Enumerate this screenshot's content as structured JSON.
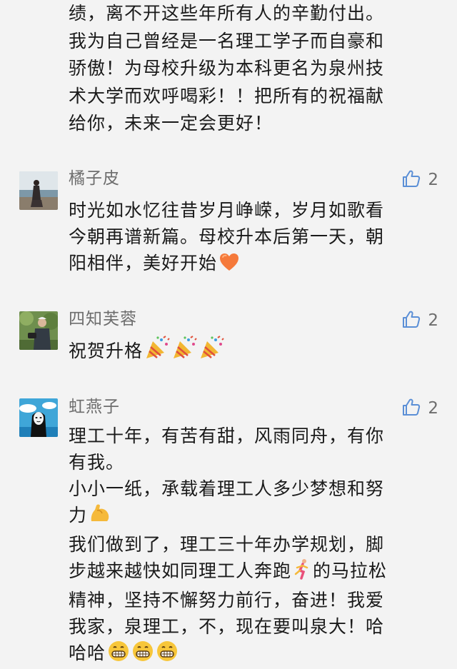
{
  "previous_comment": {
    "lines": [
      "绩，离不开这些年所有人的辛勤付出。",
      "我为自己曾经是一名理工学子而自豪和",
      "骄傲！为母校升级为本科更名为泉州技",
      "术大学而欢呼喝彩！！把所有的祝福献",
      "给你，未来一定会更好！"
    ]
  },
  "comments": [
    {
      "nickname": "橘子皮",
      "likes": "2",
      "lines": [
        "时光如水忆往昔岁月峥嵘，岁月如歌看",
        "今朝再谱新篇。母校升本后第一天，朝",
        "阳相伴，美好开始"
      ]
    },
    {
      "nickname": "四知芙蓉",
      "likes": "2",
      "lines": [
        "祝贺升格"
      ]
    },
    {
      "nickname": "虹燕子",
      "likes": "2",
      "lines": [
        "理工十年，有苦有甜，风雨同舟，有你",
        "有我。",
        "小小一纸，承载着理工人多少梦想和努",
        "力",
        "我们做到了，理工三十年办学规划，脚",
        "步越来越快如同理工人奔跑",
        "的马拉松",
        "精神，坚持不懈努力前行，奋进！我爱",
        "我家，泉理工，不，现在要叫泉大！哈",
        "哈哈"
      ]
    }
  ],
  "icons": {
    "like": "thumbs-up-icon",
    "heart": "orange-heart-emoji",
    "party": "party-popper-emoji",
    "muscle": "flexed-biceps-emoji",
    "runner": "person-running-emoji",
    "grin": "grinning-face-emoji"
  },
  "colors": {
    "background": "#f3f3f3",
    "text": "#1a1a1a",
    "meta": "#6d6d6d",
    "like_icon": "#5b8fd6"
  }
}
